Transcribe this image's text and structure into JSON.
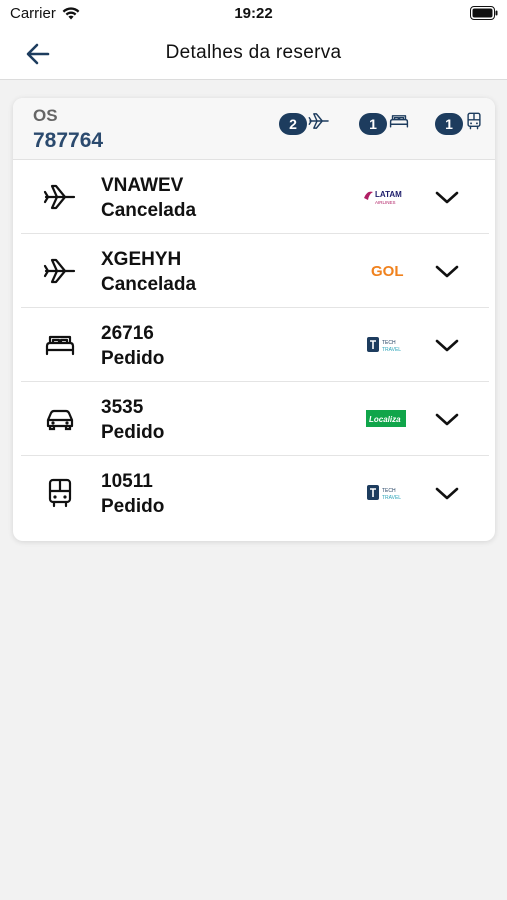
{
  "status_bar": {
    "carrier": "Carrier",
    "time": "19:22"
  },
  "nav": {
    "title": "Detalhes da reserva"
  },
  "booking": {
    "os_label": "OS",
    "os_number": "787764",
    "summary": [
      {
        "count": "2",
        "icon": "plane-icon"
      },
      {
        "count": "1",
        "icon": "bed-icon"
      },
      {
        "count": "1",
        "icon": "bus-icon"
      }
    ]
  },
  "reservations": [
    {
      "code": "VNAWEV",
      "status": "Cancelada",
      "type": "plane-icon",
      "provider": "LATAM",
      "provider_sub": "AIRLINES",
      "provider_color": "#b01e64"
    },
    {
      "code": "XGEHYH",
      "status": "Cancelada",
      "type": "plane-icon",
      "provider": "GOL",
      "provider_color": "#f0821e"
    },
    {
      "code": "26716",
      "status": "Pedido",
      "type": "bed-icon",
      "provider": "TECH",
      "provider_sub": "TRAVEL",
      "provider_color": "#1d3c5e"
    },
    {
      "code": "3535",
      "status": "Pedido",
      "type": "car-icon",
      "provider": "Localiza",
      "provider_color": "#10a54a"
    },
    {
      "code": "10511",
      "status": "Pedido",
      "type": "bus-icon",
      "provider": "TECH",
      "provider_sub": "TRAVEL",
      "provider_color": "#1d3c5e"
    }
  ]
}
